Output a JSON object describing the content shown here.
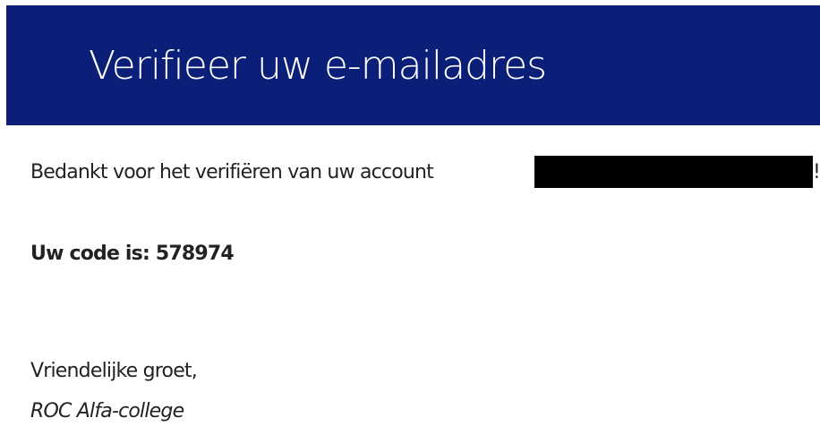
{
  "header": {
    "title": "Verifieer uw e-mailadres"
  },
  "message": {
    "thanks_text": "Bedankt voor het verifiëren van uw account",
    "thanks_suffix": "!",
    "code_line": "Uw code is: 578974",
    "greeting": "Vriendelijke groet,",
    "sender": "ROC Alfa-college"
  },
  "colors": {
    "header_background": "#0b1f78",
    "header_text": "#ffffff",
    "redaction": "#000000"
  }
}
